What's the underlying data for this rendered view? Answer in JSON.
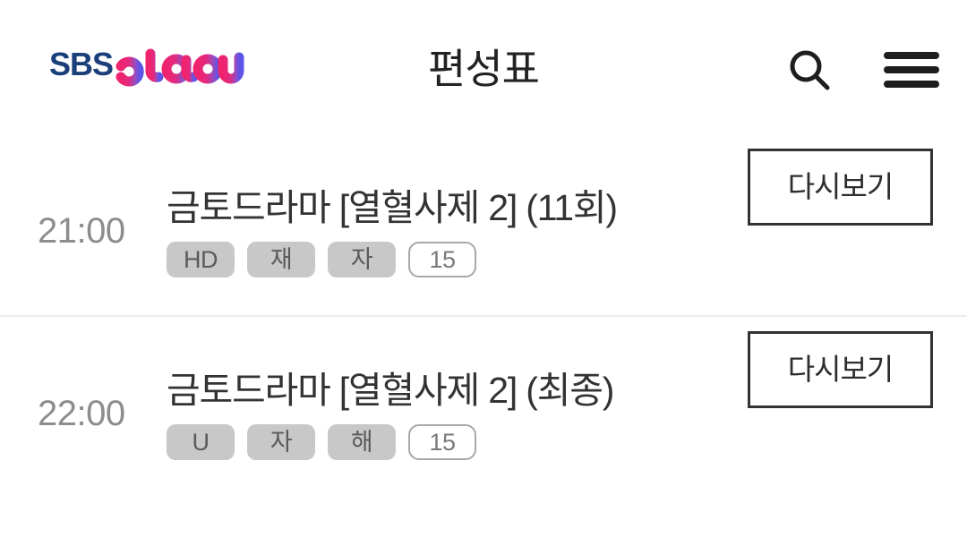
{
  "header": {
    "logo": {
      "name": "sbs-play-logo",
      "text_primary": "SBS",
      "text_secondary": "play",
      "color_primary": "#1b3f7a",
      "color_gradient_start": "#f0246e",
      "color_gradient_mid": "#c43c9a",
      "color_gradient_end": "#6a5ae0"
    },
    "title": "편성표",
    "search_icon": "search-icon",
    "menu_icon": "hamburger-menu-icon"
  },
  "schedule": {
    "rows": [
      {
        "time": "21:00",
        "title": "금토드라마 [열혈사제 2] (11회)",
        "badges": [
          {
            "label": "HD",
            "style": "filled"
          },
          {
            "label": "재",
            "style": "filled"
          },
          {
            "label": "자",
            "style": "filled"
          },
          {
            "label": "15",
            "style": "outline"
          }
        ],
        "action_label": "다시보기"
      },
      {
        "time": "22:00",
        "title": "금토드라마 [열혈사제 2] (최종)",
        "badges": [
          {
            "label": "U",
            "style": "filled"
          },
          {
            "label": "자",
            "style": "filled"
          },
          {
            "label": "해",
            "style": "filled"
          },
          {
            "label": "15",
            "style": "outline"
          }
        ],
        "action_label": "다시보기"
      }
    ]
  },
  "colors": {
    "text_primary": "#333333",
    "text_muted": "#8d8d8d",
    "badge_fill": "#c8c8c8",
    "divider": "#ececec",
    "button_border": "#333333"
  }
}
